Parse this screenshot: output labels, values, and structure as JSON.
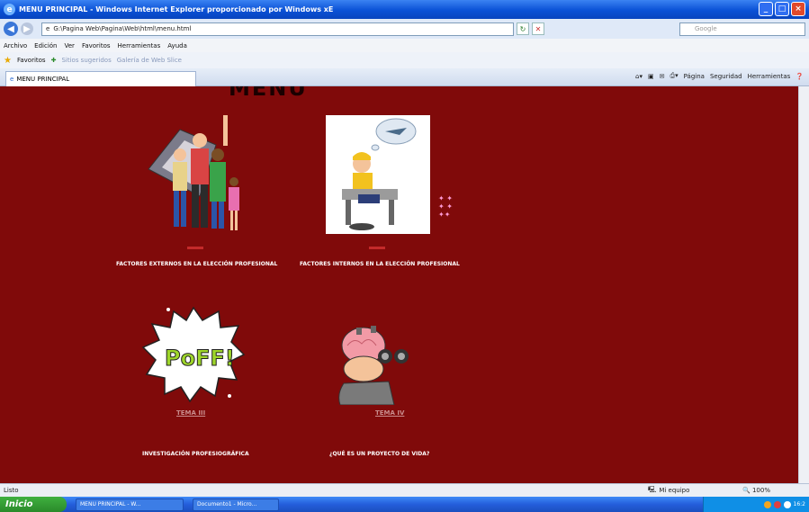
{
  "window": {
    "title": "MENU PRINCIPAL - Windows Internet Explorer proporcionado por Windows xE",
    "icon": "ie-icon"
  },
  "address": {
    "url": "G:\\Pagina Web\\Pagina\\Web\\html\\menu.html",
    "search_placeholder": "Google"
  },
  "menubar": {
    "items": [
      "Archivo",
      "Edición",
      "Ver",
      "Favoritos",
      "Herramientas",
      "Ayuda"
    ]
  },
  "favorites": {
    "label": "Favoritos",
    "links": [
      "Sitios sugeridos",
      "Galería de Web Slice"
    ]
  },
  "tab": {
    "label": "MENU PRINCIPAL"
  },
  "tools": {
    "items": [
      "Página",
      "Seguridad",
      "Herramientas"
    ]
  },
  "page": {
    "heading": "MENU",
    "items": [
      {
        "caption": "FACTORES EXTERNOS EN LA ELECCIÓN PROFESIONAL",
        "image": "family-clipart"
      },
      {
        "caption": "FACTORES INTERNOS EN LA ELECCIÓN PROFESIONAL",
        "image": "student-thinking-clipart"
      },
      {
        "tema": "TEMA III",
        "caption": "INVESTIGACIÓN PROFESIOGRÁFICA",
        "image": "poff-clipart"
      },
      {
        "tema": "TEMA IV",
        "caption": "¿QUÉ ES UN PROYECTO DE VIDA?",
        "image": "thinker-clipart"
      }
    ]
  },
  "status": {
    "text": "Listo",
    "zone": "Mi equipo",
    "zoom": "100%"
  },
  "taskbar": {
    "start": "Inicio",
    "buttons": [
      "MENU PRINCIPAL - W...",
      "Documento1 - Micro..."
    ],
    "clock": "16:2"
  },
  "colors": {
    "page_background": "#800a0a",
    "caption_text": "#ffffff",
    "link_text": "#c98c8c"
  }
}
